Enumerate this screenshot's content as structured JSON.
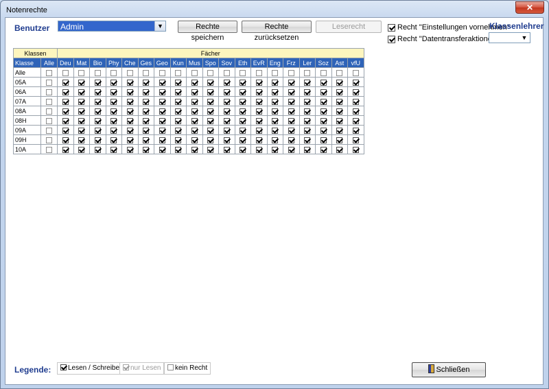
{
  "window": {
    "title": "Notenrechte",
    "close_glyph": "✕"
  },
  "top": {
    "benutzer_label": "Benutzer",
    "user_value": "Admin",
    "save_label": "Rechte speichern",
    "reset_label": "Rechte zurücksetzen",
    "readright_label": "Leserecht",
    "right_settings_label": "Recht \"Einstellungen vornehmen\"",
    "right_settings_checked": true,
    "right_transfer_label": "Recht \"Datentransferaktionen\"",
    "right_transfer_checked": true,
    "klassenlehrer_label": "Klassenlehrer",
    "klassenlehrer_value": ""
  },
  "grid": {
    "group_klassen": "Klassen",
    "group_faecher": "Fächer",
    "col_klasse": "Klasse",
    "col_alle": "Alle",
    "subjects": [
      "Deu",
      "Mat",
      "Bio",
      "Phy",
      "Che",
      "Ges",
      "Geo",
      "Kun",
      "Mus",
      "Spo",
      "Sov",
      "Eth",
      "EvR",
      "Eng",
      "Frz",
      "Ler",
      "Soz",
      "Ast",
      "vfU"
    ],
    "rows": [
      {
        "label": "Alle",
        "alle": false,
        "values": [
          false,
          false,
          false,
          false,
          false,
          false,
          false,
          false,
          false,
          false,
          false,
          false,
          false,
          false,
          false,
          false,
          false,
          false,
          false
        ]
      },
      {
        "label": "05A",
        "alle": false,
        "values": [
          true,
          true,
          true,
          true,
          true,
          true,
          true,
          true,
          true,
          true,
          true,
          true,
          true,
          true,
          true,
          true,
          true,
          true,
          true
        ]
      },
      {
        "label": "06A",
        "alle": false,
        "values": [
          true,
          true,
          true,
          true,
          true,
          true,
          true,
          true,
          true,
          true,
          true,
          true,
          true,
          true,
          true,
          true,
          true,
          true,
          true
        ]
      },
      {
        "label": "07A",
        "alle": false,
        "values": [
          true,
          true,
          true,
          true,
          true,
          true,
          true,
          true,
          true,
          true,
          true,
          true,
          true,
          true,
          true,
          true,
          true,
          true,
          true
        ]
      },
      {
        "label": "08A",
        "alle": false,
        "values": [
          true,
          true,
          true,
          true,
          true,
          true,
          true,
          true,
          true,
          true,
          true,
          true,
          true,
          true,
          true,
          true,
          true,
          true,
          true
        ]
      },
      {
        "label": "08H",
        "alle": false,
        "values": [
          true,
          true,
          true,
          true,
          true,
          true,
          true,
          true,
          true,
          true,
          true,
          true,
          true,
          true,
          true,
          true,
          true,
          true,
          true
        ]
      },
      {
        "label": "09A",
        "alle": false,
        "values": [
          true,
          true,
          true,
          true,
          true,
          true,
          true,
          true,
          true,
          true,
          true,
          true,
          true,
          true,
          true,
          true,
          true,
          true,
          true
        ]
      },
      {
        "label": "09H",
        "alle": false,
        "values": [
          true,
          true,
          true,
          true,
          true,
          true,
          true,
          true,
          true,
          true,
          true,
          true,
          true,
          true,
          true,
          true,
          true,
          true,
          true
        ]
      },
      {
        "label": "10A",
        "alle": false,
        "values": [
          true,
          true,
          true,
          true,
          true,
          true,
          true,
          true,
          true,
          true,
          true,
          true,
          true,
          true,
          true,
          true,
          true,
          true,
          true
        ]
      }
    ]
  },
  "legend": {
    "title": "Legende:",
    "read_write": "Lesen / Schreiben",
    "read_only": "nur Lesen",
    "no_right": "kein Recht"
  },
  "close_button": {
    "label": "Schließen",
    "icon": "door-exit-icon"
  },
  "colors": {
    "header_blue": "#2e63b8",
    "header_yellow": "#fdf5be",
    "label_blue": "#1f3c8f"
  }
}
